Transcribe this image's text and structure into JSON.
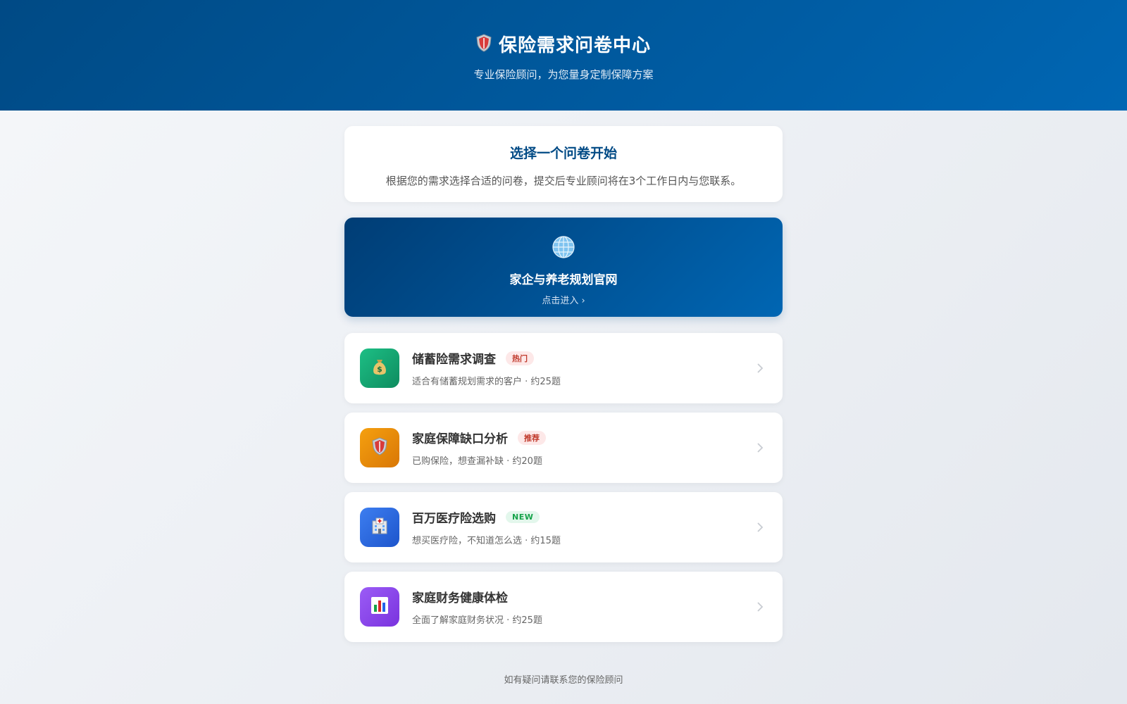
{
  "header": {
    "title": "保险需求问卷中心",
    "subtitle": "专业保险顾问，为您量身定制保障方案",
    "icon": "shield-icon"
  },
  "intro": {
    "title": "选择一个问卷开始",
    "description": "根据您的需求选择合适的问卷，提交后专业顾问将在3个工作日内与您联系。"
  },
  "banner": {
    "icon": "globe-icon",
    "title": "家企与养老规划官网",
    "link_text": "点击进入 ›"
  },
  "surveys": [
    {
      "title": "储蓄险需求调查",
      "badge": "热门",
      "description": "适合有储蓄规划需求的客户 · 约25题",
      "icon": "money-bag-icon",
      "color": "#16a373"
    },
    {
      "title": "家庭保障缺口分析",
      "badge": "推荐",
      "description": "已购保险，想查漏补缺 · 约20题",
      "icon": "shield-icon",
      "color": "#ea8a0c"
    },
    {
      "title": "百万医疗险选购",
      "badge": "NEW",
      "description": "想买医疗险，不知道怎么选 · 约15题",
      "icon": "hospital-icon",
      "color": "#2d6be0"
    },
    {
      "title": "家庭财务健康体检",
      "description": "全面了解家庭财务状况 · 约25题",
      "icon": "bar-chart-icon",
      "color": "#8a45e6"
    }
  ],
  "footer": {
    "text": "如有疑问请联系您的保险顾问"
  }
}
